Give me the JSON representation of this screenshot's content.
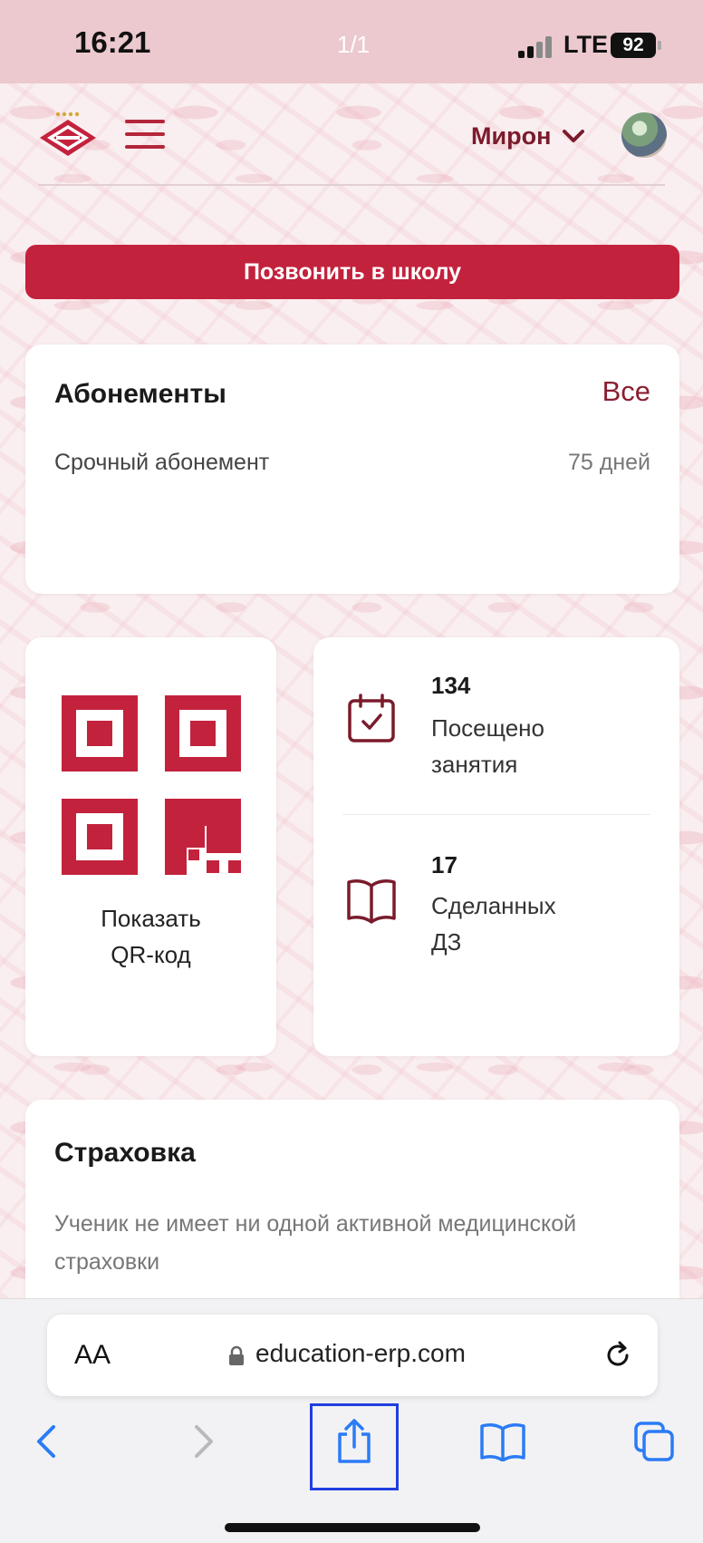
{
  "status_bar": {
    "time": "16:21",
    "page_indicator": "1/1",
    "network": "LTE",
    "battery": "92"
  },
  "header": {
    "user_name": "Мирон",
    "logo_icon": "spartak-logo-icon",
    "menu_icon": "hamburger-menu-icon",
    "brand_color": "#c3223d"
  },
  "call_button": {
    "label": "Позвонить в школу"
  },
  "subscriptions": {
    "title": "Абонементы",
    "all_link": "Все",
    "item_name": "Срочный абонемент",
    "item_days": "75 дней"
  },
  "qr": {
    "caption_line1": "Показать",
    "caption_line2": "QR-код"
  },
  "stats": {
    "visits_count": "134",
    "visits_label_line1": "Посещено",
    "visits_label_line2": "занятия",
    "homework_count": "17",
    "homework_label_line1": "Сделанных",
    "homework_label_line2": "ДЗ"
  },
  "insurance": {
    "title": "Страховка",
    "text": "Ученик не имеет ни одной активной медицинской страховки"
  },
  "browser": {
    "text_size_label": "AA",
    "url": "education-erp.com"
  }
}
